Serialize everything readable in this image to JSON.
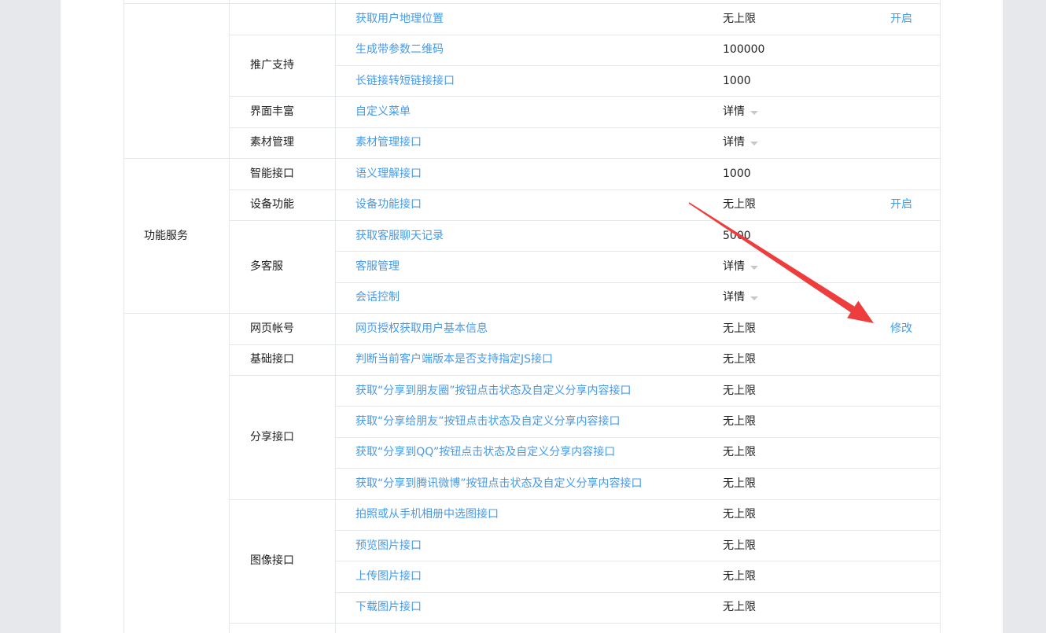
{
  "colors": {
    "link": "#459ae9",
    "annotation_arrow": "#ee3d3d",
    "border": "#e4e8eb"
  },
  "rows": [
    {
      "api": "获取用户地理位置",
      "limit": "无上限",
      "op": "开启"
    },
    {
      "api": "生成带参数二维码",
      "limit": "100000"
    },
    {
      "api": "长链接转短链接接口",
      "limit": "1000"
    },
    {
      "api": "自定义菜单",
      "limit": "详情",
      "dropdown": true
    },
    {
      "api": "素材管理接口",
      "limit": "详情",
      "dropdown": true
    },
    {
      "api": "语义理解接口",
      "limit": "1000"
    },
    {
      "api": "设备功能接口",
      "limit": "无上限",
      "op": "开启"
    },
    {
      "api": "获取客服聊天记录",
      "limit": "5000"
    },
    {
      "api": "客服管理",
      "limit": "详情",
      "dropdown": true
    },
    {
      "api": "会话控制",
      "limit": "详情",
      "dropdown": true
    },
    {
      "api": "网页授权获取用户基本信息",
      "limit": "无上限",
      "op": "修改"
    },
    {
      "api": "判断当前客户端版本是否支持指定JS接口",
      "limit": "无上限"
    },
    {
      "api": "获取“分享到朋友圈”按钮点击状态及自定义分享内容接口",
      "limit": "无上限"
    },
    {
      "api": "获取“分享给朋友”按钮点击状态及自定义分享内容接口",
      "limit": "无上限"
    },
    {
      "api": "获取“分享到QQ”按钮点击状态及自定义分享内容接口",
      "limit": "无上限"
    },
    {
      "api": "获取“分享到腾讯微博”按钮点击状态及自定义分享内容接口",
      "limit": "无上限"
    },
    {
      "api": "拍照或从手机相册中选图接口",
      "limit": "无上限"
    },
    {
      "api": "预览图片接口",
      "limit": "无上限"
    },
    {
      "api": "上传图片接口",
      "limit": "无上限"
    },
    {
      "api": "下载图片接口",
      "limit": "无上限"
    }
  ],
  "groups": [
    {
      "label": "",
      "start": 0,
      "span": 1
    },
    {
      "label": "推广支持",
      "start": 1,
      "span": 2
    },
    {
      "label": "界面丰富",
      "start": 3,
      "span": 1
    },
    {
      "label": "素材管理",
      "start": 4,
      "span": 1
    },
    {
      "label": "智能接口",
      "start": 5,
      "span": 1
    },
    {
      "label": "设备功能",
      "start": 6,
      "span": 1
    },
    {
      "label": "多客服",
      "start": 7,
      "span": 3
    },
    {
      "label": "网页帐号",
      "start": 10,
      "span": 1
    },
    {
      "label": "基础接口",
      "start": 11,
      "span": 1
    },
    {
      "label": "分享接口",
      "start": 12,
      "span": 4
    },
    {
      "label": "图像接口",
      "start": 16,
      "span": 4
    }
  ],
  "categories": [
    {
      "label": "",
      "start": 0,
      "span": 5
    },
    {
      "label": "功能服务",
      "start": 5,
      "span": 5
    },
    {
      "label": "",
      "start": 10,
      "span": 11
    }
  ]
}
